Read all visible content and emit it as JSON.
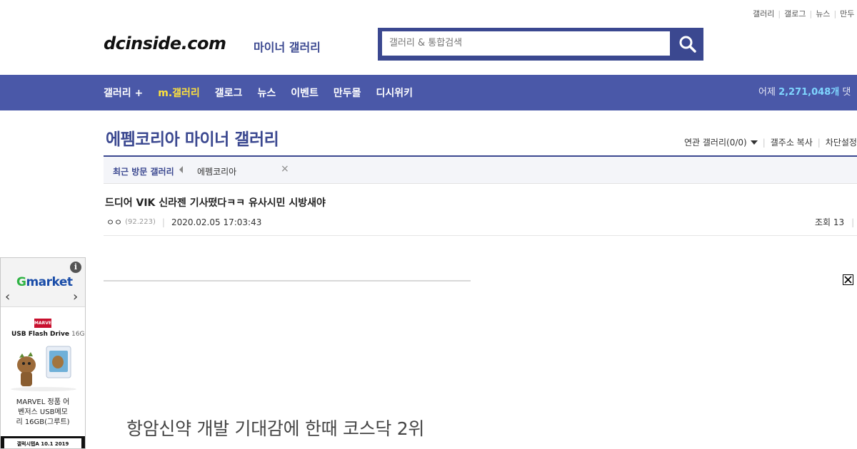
{
  "util_links": [
    "갤러리",
    "갤로그",
    "뉴스",
    "만두"
  ],
  "logo": {
    "text": "dcinside.com",
    "sub": "마이너 갤러리"
  },
  "search": {
    "placeholder": "갤러리 & 통합검색",
    "icon": "search-icon"
  },
  "nav": {
    "items": [
      "갤러리 +",
      "m.갤러리",
      "갤로그",
      "뉴스",
      "이벤트",
      "만두몰",
      "디시위키"
    ],
    "active_index": 1,
    "stat_prefix": "어제",
    "stat_value": "2,271,048개",
    "stat_suffix": "댓"
  },
  "gallery": {
    "title": "에펨코리아 마이너 갤러리",
    "links": [
      "연관 갤러리(0/0)",
      "갤주소 복사",
      "차단설정"
    ]
  },
  "recent": {
    "label": "최근 방문 갤러리",
    "items": [
      "에펨코리아"
    ],
    "close": "×"
  },
  "post": {
    "title": "드디어 VIK 신라젠 기사떴다ㅋㅋ 유사시민 시방새야",
    "author": "ㅇㅇ",
    "ip": "(92.223)",
    "date": "2020.02.05 17:03:43",
    "views_label": "조회 13",
    "content_headline": "항암신약 개발 기대감에 한때 코스닥 2위"
  },
  "ad": {
    "brand_g": "G",
    "brand_rest": "market",
    "info": "i",
    "marvel": "MARVEL",
    "product_line": "USB Flash Drive",
    "capacity": "16G",
    "desc_lines": [
      "MARVEL 정품 어",
      "벤저스 USB메모",
      "리 16GB(그루트)"
    ],
    "bottom_text": "갤럭시탭A 10.1 2019",
    "prev": "‹",
    "next": "›"
  },
  "colors": {
    "brand": "#3b4890",
    "nav_bg": "#4a58a8",
    "nav_active": "#ffe23c",
    "stat_num": "#7fd6ff"
  }
}
